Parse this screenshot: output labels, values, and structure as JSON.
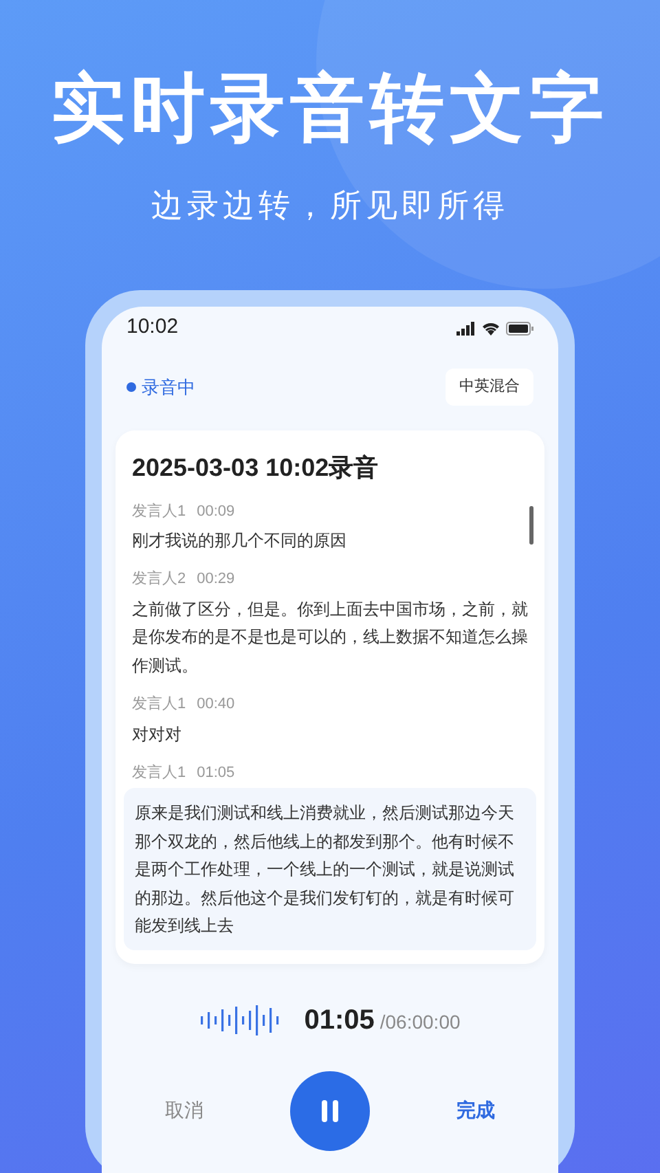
{
  "headline": "实时录音转文字",
  "subtitle": "边录边转，所见即所得",
  "status_bar": {
    "time": "10:02"
  },
  "recording": {
    "status": "录音中",
    "language": "中英混合"
  },
  "transcript": {
    "title": "2025-03-03 10:02录音",
    "entries": [
      {
        "speaker": "发言人1",
        "time": "00:09",
        "text": "刚才我说的那几个不同的原因",
        "selected": false
      },
      {
        "speaker": "发言人2",
        "time": "00:29",
        "text": "之前做了区分，但是。你到上面去中国市场，之前，就是你发布的是不是也是可以的，线上数据不知道怎么操作测试。",
        "selected": false
      },
      {
        "speaker": "发言人1",
        "time": "00:40",
        "text": "对对对",
        "selected": false
      },
      {
        "speaker": "发言人1",
        "time": "01:05",
        "text": "原来是我们测试和线上消费就业，然后测试那边今天那个双龙的，然后他线上的都发到那个。他有时候不是两个工作处理，一个线上的一个测试，就是说测试的那边。然后他这个是我们发钉钉的，就是有时候可能发到线上去",
        "selected": true
      }
    ]
  },
  "timer": {
    "elapsed": "01:05",
    "limit": "/06:00:00"
  },
  "controls": {
    "cancel": "取消",
    "done": "完成"
  }
}
